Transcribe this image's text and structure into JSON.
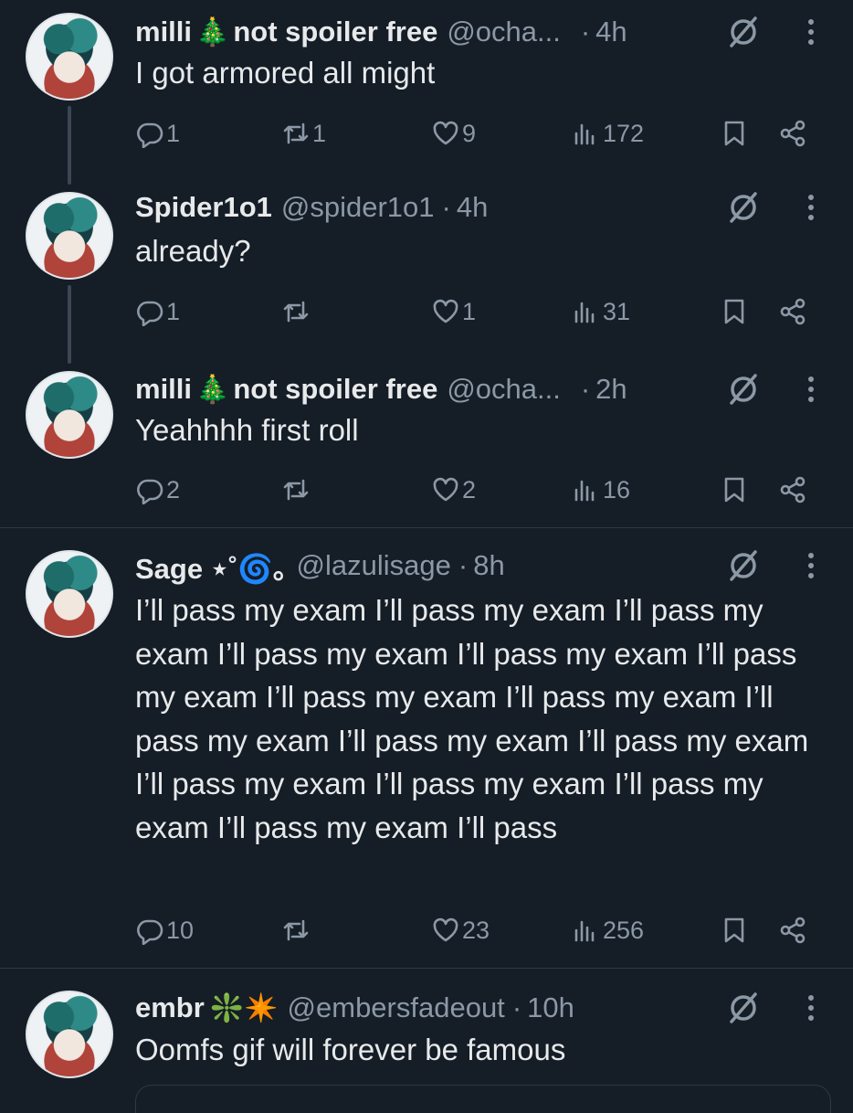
{
  "tweets": [
    {
      "name": "milli",
      "name_emoji": "🎄",
      "name_suffix": "not spoiler free",
      "handle": "@ocha...",
      "dot": "·",
      "time": "4h",
      "text": "I got armored all might",
      "replies": "1",
      "reposts": "1",
      "likes": "9",
      "views": "172"
    },
    {
      "name": "Spider1o1",
      "handle": "@spider1o1",
      "dot": "·",
      "time": "4h",
      "text": "already?",
      "replies": "1",
      "reposts": "",
      "likes": "1",
      "views": "31"
    },
    {
      "name": "milli",
      "name_emoji": "🎄",
      "name_suffix": "not spoiler free",
      "handle": "@ocha...",
      "dot": "·",
      "time": "2h",
      "text": "Yeahhhh first roll",
      "replies": "2",
      "reposts": "",
      "likes": "2",
      "views": "16"
    },
    {
      "name": "Sage ⋆˚🌀｡",
      "handle": "@lazulisage",
      "dot": "·",
      "time": "8h",
      "text": "I’ll pass my exam I’ll pass my exam I’ll pass my exam I’ll pass my exam I’ll pass my exam I’ll pass my exam I’ll pass my exam I’ll pass my exam I’ll pass my exam I’ll pass my exam I’ll pass my exam I’ll pass my exam I’ll pass my exam I’ll pass my exam I’ll pass my exam I’ll pass",
      "replies": "10",
      "reposts": "",
      "likes": "23",
      "views": "256"
    },
    {
      "name": "embr",
      "name_emoji": "❇️✴️",
      "handle": "@embersfadeout",
      "dot": "·",
      "time": "10h",
      "text": "Oomfs gif will forever be famous"
    }
  ],
  "icons": {
    "reply": "reply-icon",
    "repost": "repost-icon",
    "like": "heart-icon",
    "views": "views-icon",
    "bookmark": "bookmark-icon",
    "share": "share-icon",
    "grok": "grok-icon",
    "more": "more-icon"
  },
  "colors": {
    "background": "#151d27",
    "text": "#e7e9ea",
    "muted": "#8b98a5",
    "divider": "#2f3943"
  }
}
